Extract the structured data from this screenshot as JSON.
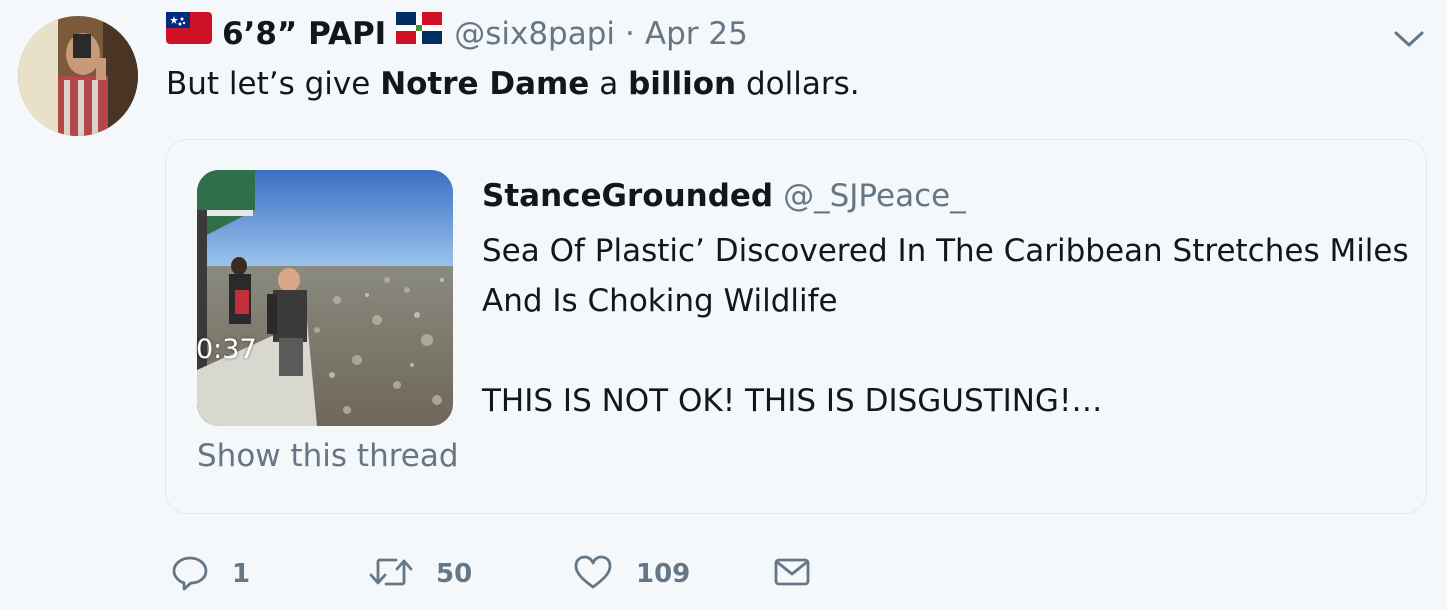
{
  "tweet": {
    "display_name": "6’8” PAPI",
    "handle": "@six8papi",
    "separator": "·",
    "date": "Apr 25",
    "text": {
      "part1": "But let’s give ",
      "bold1": "Notre Dame",
      "part2": " a ",
      "bold2": "billion",
      "part3": " dollars."
    },
    "flags": [
      "samoa-flag-icon",
      "dominican-republic-flag-icon"
    ]
  },
  "quote": {
    "name": "StanceGrounded",
    "handle": "@_SJPeace_",
    "line1": "Sea Of Plastic’ Discovered In The Caribbean Stretches Miles",
    "line2": "And Is Choking Wildlife",
    "line3": "THIS IS NOT OK! THIS IS DISGUSTING!…",
    "video_duration": "0:37",
    "show_thread": "Show this thread"
  },
  "actions": {
    "reply_count": "1",
    "retweet_count": "50",
    "like_count": "109",
    "icons": [
      "reply-icon",
      "retweet-icon",
      "like-icon",
      "direct-message-icon"
    ]
  },
  "colors": {
    "background": "#f5f8fa",
    "text": "#14171a",
    "secondary": "#657786",
    "border": "#e1e8ed"
  }
}
